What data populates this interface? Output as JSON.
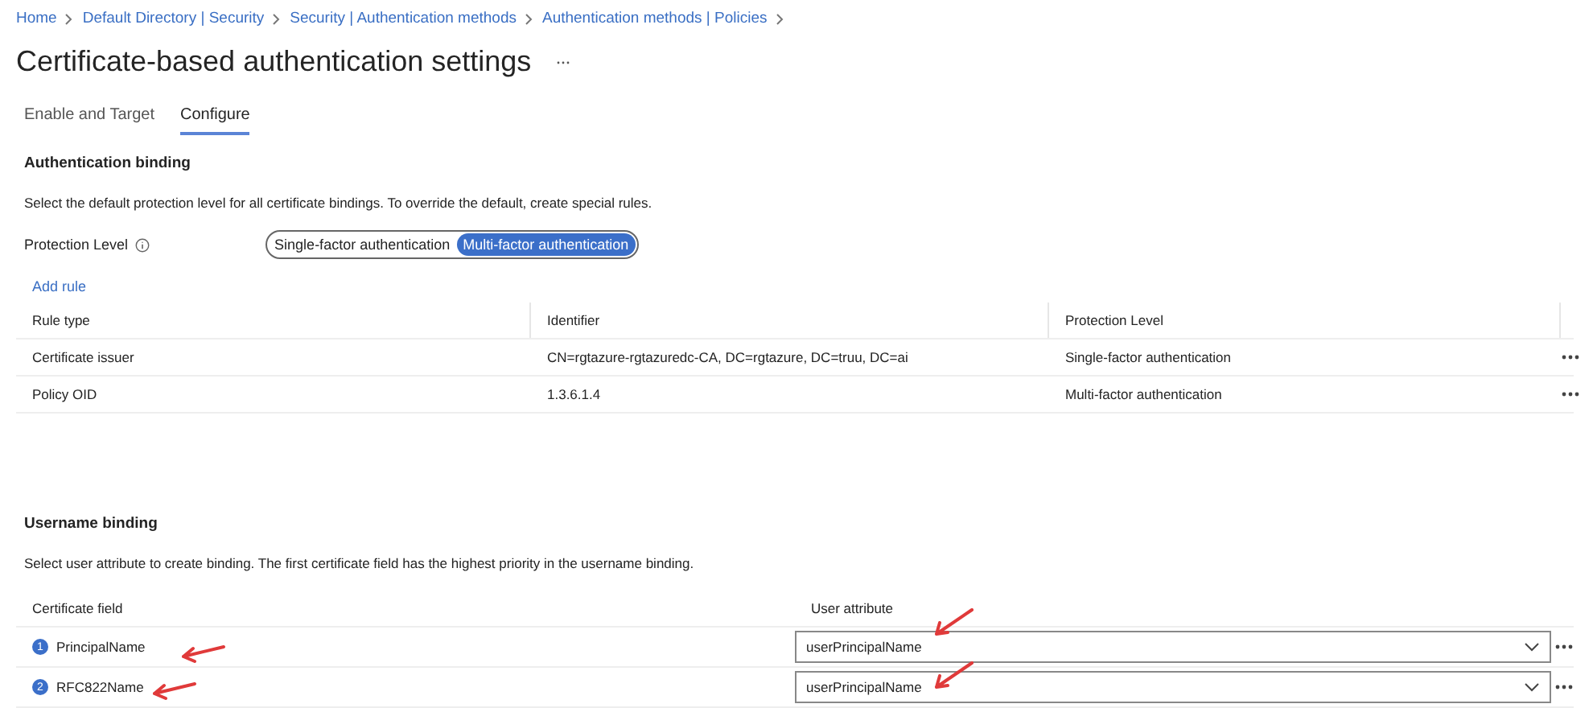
{
  "breadcrumb": [
    "Home",
    "Default Directory | Security",
    "Security | Authentication methods",
    "Authentication methods | Policies"
  ],
  "title": "Certificate-based authentication settings",
  "tabs": [
    {
      "label": "Enable and Target",
      "selected": false
    },
    {
      "label": "Configure",
      "selected": true
    }
  ],
  "authentication_binding": {
    "heading": "Authentication binding",
    "description": "Select the default protection level for all certificate bindings. To override the default, create special rules.",
    "protection_label": "Protection Level",
    "protection_options": [
      {
        "label": "Single-factor authentication",
        "selected": false
      },
      {
        "label": "Multi-factor authentication",
        "selected": true
      }
    ],
    "add_rule": "Add rule",
    "table": {
      "columns": [
        "Rule type",
        "Identifier",
        "Protection Level"
      ],
      "rows": [
        [
          "Certificate issuer",
          "CN=rgtazure-rgtazuredc-CA, DC=rgtazure, DC=truu, DC=ai",
          "Single-factor authentication"
        ],
        [
          "Policy OID",
          "1.3.6.1.4",
          "Multi-factor authentication"
        ]
      ]
    }
  },
  "username_binding": {
    "heading": "Username binding",
    "description": "Select user attribute to create binding. The first certificate field has the highest priority in the username binding.",
    "columns": [
      "Certificate field",
      "User attribute"
    ],
    "rows": [
      {
        "priority": "1",
        "field": "PrincipalName",
        "attribute": "userPrincipalName",
        "field_arrow": true,
        "attribute_arrow": true
      },
      {
        "priority": "2",
        "field": "RFC822Name",
        "attribute": "userPrincipalName",
        "field_arrow": true,
        "attribute_arrow": true
      }
    ]
  }
}
